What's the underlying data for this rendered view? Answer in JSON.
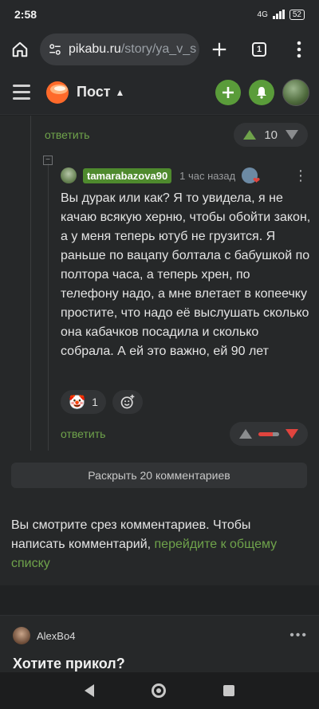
{
  "status": {
    "time": "2:58",
    "network": "4G",
    "battery": "52"
  },
  "browser": {
    "url_host": "pikabu.ru",
    "url_path": "/story/ya_v_s",
    "tab_count": "1"
  },
  "header": {
    "title": "Пост"
  },
  "parent_comment": {
    "reply_label": "ответить",
    "score": "10"
  },
  "comment": {
    "author": "tamarabazova90",
    "time": "1 час назад",
    "text": "Вы дурак или как? Я то увидела, я не качаю всякую херню, чтобы обойти закон, а у меня теперь ютуб не грузится. Я раньше по вацапу болтала с бабушкой по полтора часа, а теперь хрен, по телефону надо, а мне влетает в копеечку простите, что надо её выслушать сколько она кабачков посадила и сколько собрала. А ей это важно, ей 90 лет",
    "reaction_count": "1",
    "reply_label": "ответить"
  },
  "expand_label": "Раскрыть 20 комментариев",
  "hint": {
    "text": "Вы смотрите срез комментариев. Чтобы написать комментарий, ",
    "link": "перейдите к общему списку"
  },
  "next_post": {
    "author": "AlexBo4",
    "title": "Хотите прикол?"
  },
  "colors": {
    "accent_green": "#5a9c3a",
    "downvote_red": "#e0443e",
    "background": "#202223"
  }
}
